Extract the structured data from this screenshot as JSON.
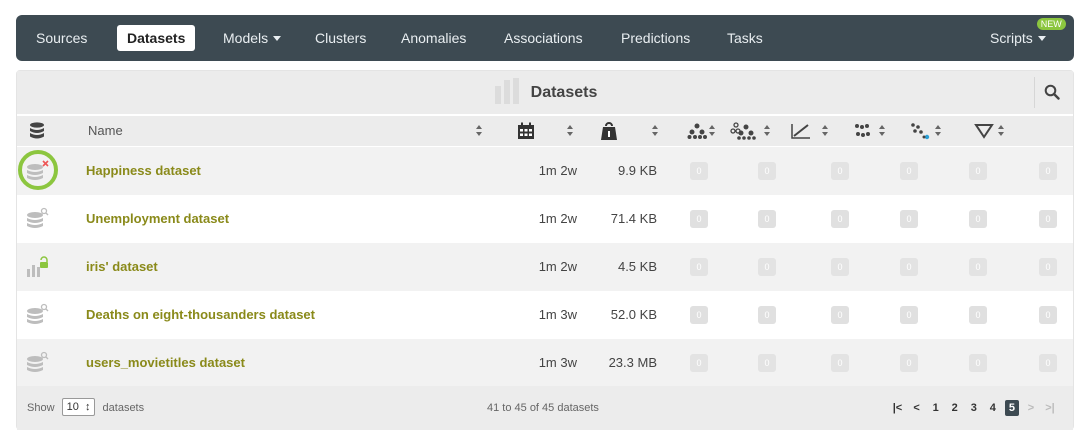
{
  "nav": {
    "items": [
      {
        "label": "Sources"
      },
      {
        "label": "Datasets"
      },
      {
        "label": "Models"
      },
      {
        "label": "Clusters"
      },
      {
        "label": "Anomalies"
      },
      {
        "label": "Associations"
      },
      {
        "label": "Predictions"
      },
      {
        "label": "Tasks"
      },
      {
        "label": "Scripts"
      }
    ],
    "new_badge": "NEW",
    "active": "Datasets"
  },
  "section": {
    "title": "Datasets"
  },
  "table": {
    "headers": {
      "name": "Name"
    },
    "rows": [
      {
        "name": "Happiness dataset",
        "age": "1m 2w",
        "size": "9.9 KB",
        "counts": [
          "0",
          "0",
          "0",
          "0",
          "0",
          "0"
        ]
      },
      {
        "name": "Unemployment dataset",
        "age": "1m 2w",
        "size": "71.4 KB",
        "counts": [
          "0",
          "0",
          "0",
          "0",
          "0",
          "0"
        ]
      },
      {
        "name": "iris' dataset",
        "age": "1m 2w",
        "size": "4.5 KB",
        "counts": [
          "0",
          "0",
          "0",
          "0",
          "0",
          "0"
        ]
      },
      {
        "name": "Deaths on eight-thousanders dataset",
        "age": "1m 3w",
        "size": "52.0 KB",
        "counts": [
          "0",
          "0",
          "0",
          "0",
          "0",
          "0"
        ]
      },
      {
        "name": "users_movietitles dataset",
        "age": "1m 3w",
        "size": "23.3 MB",
        "counts": [
          "0",
          "0",
          "0",
          "0",
          "0",
          "0"
        ]
      }
    ]
  },
  "footer": {
    "show_label": "Show",
    "per_page": "10",
    "unit_label": "datasets",
    "range_text": "41 to 45 of 45 datasets",
    "pages": [
      "1",
      "2",
      "3",
      "4",
      "5"
    ],
    "current_page": "5"
  },
  "colors": {
    "nav_bg": "#3d4a52",
    "link": "#8a8a1a",
    "accent_green": "#8cc63f"
  }
}
